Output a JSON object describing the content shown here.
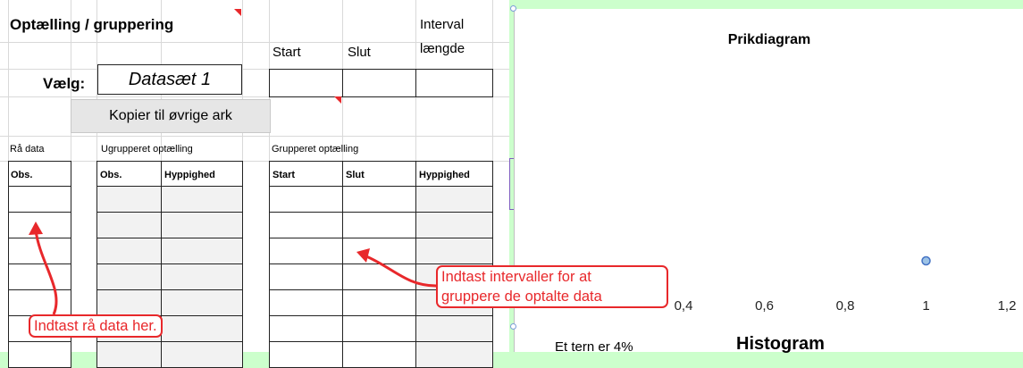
{
  "sheet": {
    "title": "Optælling / gruppering",
    "select_label": "Vælg:",
    "dataset_value": "Datasæt 1",
    "copy_button": "Kopier til øvrige ark",
    "interval_headers": {
      "start": "Start",
      "slut": "Slut",
      "interval_line1": "Interval",
      "interval_line2": "længde"
    },
    "section_raw": "Rå data",
    "section_ungrouped": "Ugrupperet optælling",
    "section_grouped": "Grupperet optælling",
    "col_obs": "Obs.",
    "col_obs2": "Obs.",
    "col_hyppighed": "Hyppighed",
    "col_start": "Start",
    "col_slut": "Slut",
    "col_hyppighed2": "Hyppighed"
  },
  "callouts": {
    "raw": "Indtast rå data her.",
    "intervals_line1": "Indtast intervaller for at",
    "intervals_line2": "gruppere de optalte data"
  },
  "chart_data": {
    "type": "scatter",
    "title": "Prikdiagram",
    "x_ticks": [
      "0,4",
      "0,6",
      "0,8",
      "1",
      "1,2"
    ],
    "xlim_visible": [
      0.4,
      1.2
    ],
    "series": [
      {
        "points": [
          {
            "x": 1,
            "y": 0
          }
        ]
      }
    ],
    "marker_color": "#9dc3e6",
    "marker_edge": "#4472c4"
  },
  "histogram": {
    "note": "Et tern er 4%",
    "title": "Histogram"
  },
  "colors": {
    "accent_red": "#e8282b",
    "background": "#ccffcc"
  }
}
